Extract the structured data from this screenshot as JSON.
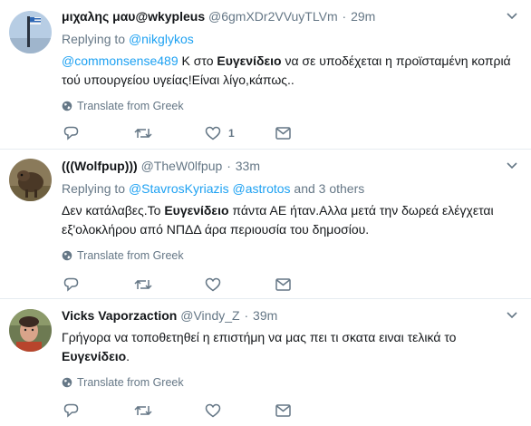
{
  "tweets": [
    {
      "name": "μιχαλης μαυ@wkypleus",
      "handle": "@6gmXDr2VVuyTLVm",
      "time": "29m",
      "replying_prefix": "Replying to",
      "replying_to": "@nikglykos",
      "text_mention": "@commonsense489",
      "text_a": " Κ στο ",
      "text_bold": "Ευγενίδειο",
      "text_b": " να σε υποδέχεται η προϊσταμένη κοπριά τού υπουργείου υγείας!Είναι λίγο,κάπως..",
      "translate": "Translate from Greek",
      "like_count": "1",
      "icons": [
        "globe-icon",
        "reply-icon",
        "retweet-icon",
        "like-icon",
        "message-icon",
        "chevron-down-icon"
      ]
    },
    {
      "name": "(((Wolfpup)))",
      "handle": "@TheW0lfpup",
      "time": "33m",
      "replying_prefix": "Replying to",
      "replying_to_1": "@StavrosKyriazis",
      "replying_to_2": "@astrotos",
      "replying_others": "and 3 others",
      "text_a": "Δεν κατάλαβες.Το ",
      "text_bold": "Ευγενίδειο",
      "text_b": " πάντα ΑΕ ήταν.Αλλα μετά την δωρεά ελέγχεται εξ'ολοκλήρου από ΝΠΔΔ άρα περιουσία του δημοσίου.",
      "translate": "Translate from Greek",
      "icons": [
        "globe-icon",
        "reply-icon",
        "retweet-icon",
        "like-icon",
        "message-icon",
        "chevron-down-icon"
      ]
    },
    {
      "name": "Vicks Vaporzaction",
      "handle": "@Vindy_Z",
      "time": "39m",
      "text_a": "Γρήγορα να τοποθετηθεί η επιστήμη να μας πει τι σκατα ειναι τελικά το ",
      "text_bold": "Ευγενίδειο",
      "text_b": ".",
      "translate": "Translate from Greek",
      "icons": [
        "globe-icon",
        "reply-icon",
        "retweet-icon",
        "like-icon",
        "message-icon",
        "chevron-down-icon"
      ]
    }
  ],
  "separator": "·",
  "colors": {
    "link": "#1da1f2",
    "muted": "#657786",
    "text": "#14171a",
    "border": "#e6ecf0"
  }
}
